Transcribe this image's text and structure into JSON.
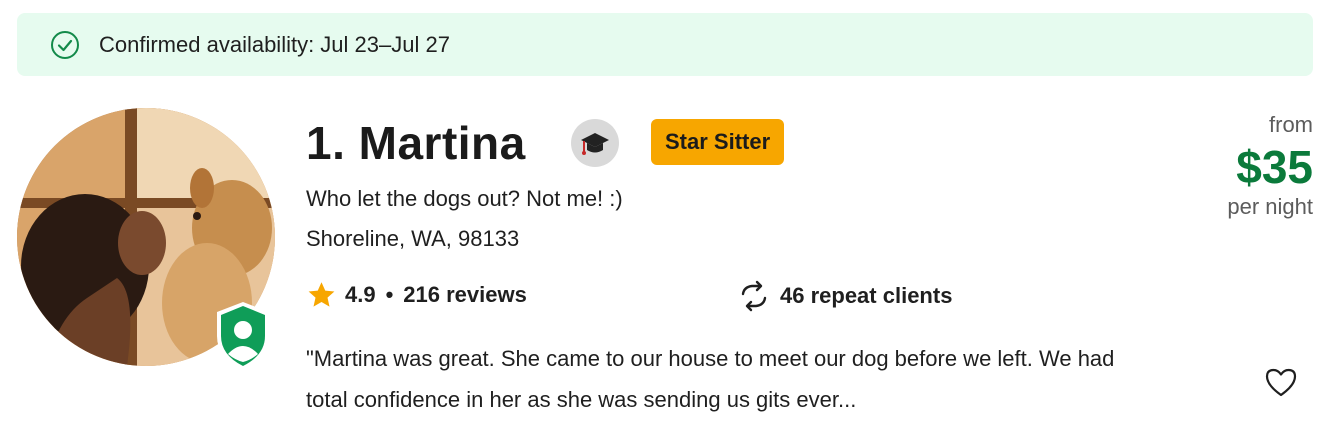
{
  "banner": {
    "text": "Confirmed availability: Jul 23–Jul 27",
    "icon": "check-circle-icon",
    "color": "#e6fbef"
  },
  "sitter": {
    "name": "1. Martina",
    "badge": "Star Sitter",
    "badge_color": "#f7a600",
    "tagline": "Who let the dogs out? Not me! :)",
    "location": "Shoreline, WA, 98133",
    "rating": "4.9",
    "reviews": "216 reviews",
    "repeat_clients": "46 repeat clients",
    "review_snippet": "\"Martina was great. She came to our house to meet our dog before we left. We had total confidence in her as she was sending us gits ever..."
  },
  "price": {
    "from": "from",
    "amount": "$35",
    "unit": "per night",
    "color": "#0b7a3b"
  }
}
